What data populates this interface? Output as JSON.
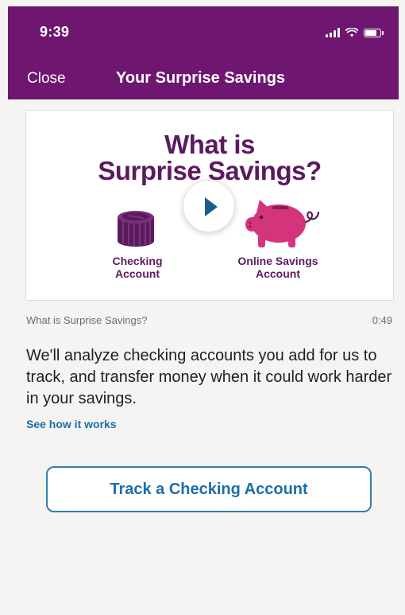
{
  "status_bar": {
    "time": "9:39"
  },
  "header": {
    "close_label": "Close",
    "title": "Your Surprise Savings"
  },
  "video": {
    "headline_line1": "What is",
    "headline_line2": "Surprise Savings?",
    "checking_label": "Checking\nAccount",
    "online_label": "Online Savings\nAccount",
    "caption": "What is Surprise Savings?",
    "duration": "0:49"
  },
  "body": {
    "description": "We'll analyze checking accounts you add for us to track, and transfer money when it could work harder in your savings.",
    "link_label": "See how it works"
  },
  "cta": {
    "label": "Track a Checking Account"
  },
  "colors": {
    "header_bg": "#6e1670",
    "brand_purple": "#5c1a5e",
    "piggy_pink": "#d4357a",
    "link_blue": "#1b6fa8",
    "play_icon": "#1b5d8c"
  },
  "icons": {
    "signal": "cellular-signal-icon",
    "wifi": "wifi-icon",
    "battery": "battery-icon",
    "play": "play-icon",
    "coins": "coin-stack-icon",
    "piggy": "piggy-bank-icon"
  }
}
